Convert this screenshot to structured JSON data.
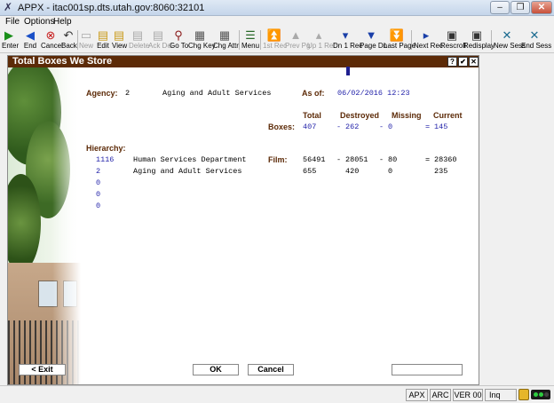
{
  "window": {
    "title": "APPX - itac001sp.dts.utah.gov:8060:32101",
    "min": "–",
    "max": "❐",
    "close": "✕"
  },
  "menu": [
    "File",
    "Options",
    "Help"
  ],
  "toolbar": [
    {
      "label": "Enter",
      "icon": "enter-icon",
      "glyph": "▶",
      "color": "#1a8f1a",
      "disabled": false
    },
    {
      "label": "End",
      "icon": "end-icon",
      "glyph": "◀",
      "color": "#1a4fc7",
      "disabled": false
    },
    {
      "label": "Cancel",
      "icon": "cancel-icon",
      "glyph": "⊗",
      "color": "#c71a1a",
      "disabled": false
    },
    {
      "label": "Back",
      "icon": "back-icon",
      "glyph": "↶",
      "color": "#333333",
      "disabled": false
    },
    {
      "label": "New",
      "icon": "new-icon",
      "glyph": "▭",
      "color": "#999999",
      "disabled": true
    },
    {
      "label": "Edit",
      "icon": "edit-icon",
      "glyph": "▤",
      "color": "#c99a1a",
      "disabled": false
    },
    {
      "label": "View",
      "icon": "view-icon",
      "glyph": "▤",
      "color": "#c99a1a",
      "disabled": false
    },
    {
      "label": "Delete",
      "icon": "delete-icon",
      "glyph": "▤",
      "color": "#999999",
      "disabled": true
    },
    {
      "label": "Ack Del",
      "icon": "ack-delete-icon",
      "glyph": "▤",
      "color": "#999999",
      "disabled": true
    },
    {
      "label": "Go To",
      "icon": "goto-icon",
      "glyph": "⚲",
      "color": "#8a1a1a",
      "disabled": false
    },
    {
      "label": "Chg Key",
      "icon": "change-key-icon",
      "glyph": "▦",
      "color": "#555555",
      "disabled": false
    },
    {
      "label": "Chg Attr",
      "icon": "change-attr-icon",
      "glyph": "▦",
      "color": "#555555",
      "disabled": false
    },
    {
      "label": "Menu",
      "icon": "menu-icon",
      "glyph": "☰",
      "color": "#2a6a2a",
      "disabled": false
    },
    {
      "label": "1st Rec",
      "icon": "first-record-icon",
      "glyph": "⏫",
      "color": "#999999",
      "disabled": true
    },
    {
      "label": "Prev Pg",
      "icon": "previous-page-icon",
      "glyph": "▲",
      "color": "#999999",
      "disabled": true
    },
    {
      "label": "Up 1 Rec",
      "icon": "up-record-icon",
      "glyph": "▴",
      "color": "#999999",
      "disabled": true
    },
    {
      "label": "Dn 1 Rec",
      "icon": "down-record-icon",
      "glyph": "▾",
      "color": "#1a3fa8",
      "disabled": false
    },
    {
      "label": "Page Dn",
      "icon": "page-down-icon",
      "glyph": "▼",
      "color": "#1a3fa8",
      "disabled": false
    },
    {
      "label": "Last Page",
      "icon": "last-page-icon",
      "glyph": "⏬",
      "color": "#1a3fa8",
      "disabled": false
    },
    {
      "label": "Next Rec",
      "icon": "next-record-icon",
      "glyph": "▸",
      "color": "#1a3fa8",
      "disabled": false
    },
    {
      "label": "Rescroll",
      "icon": "rescroll-icon",
      "glyph": "▣",
      "color": "#333333",
      "disabled": false
    },
    {
      "label": "Redisplay",
      "icon": "redisplay-icon",
      "glyph": "▣",
      "color": "#333333",
      "disabled": false
    },
    {
      "label": "New Sess",
      "icon": "new-session-icon",
      "glyph": "✕",
      "color": "#1a6a8f",
      "disabled": false
    },
    {
      "label": "End Sess",
      "icon": "end-session-icon",
      "glyph": "✕",
      "color": "#1a6a8f",
      "disabled": false
    }
  ],
  "form": {
    "header_title": "Total Boxes We Store",
    "header_buttons": [
      "?",
      "✔",
      "✕"
    ],
    "agency_label": "Agency:",
    "agency_code": "2",
    "agency_name": "Aging and Adult Services",
    "as_of_label": "As of:",
    "as_of_value": "06/02/2016 12:23",
    "col_total": "Total",
    "col_destroyed": "Destroyed",
    "col_missing": "Missing",
    "col_current": "Current",
    "boxes_label": "Boxes:",
    "boxes": {
      "total": "407",
      "minus1": "-",
      "destroyed": "262",
      "minus2": "-",
      "missing": "0",
      "equals": "=",
      "current": "145"
    },
    "hierarchy_label": "Hierarchy:",
    "hierarchy": [
      {
        "code": "1116",
        "name": "Human Services Department"
      },
      {
        "code": "2",
        "name": "Aging and Adult Services"
      },
      {
        "code": "0",
        "name": ""
      },
      {
        "code": "0",
        "name": ""
      },
      {
        "code": "0",
        "name": ""
      }
    ],
    "film_label": "Film:",
    "film_rows": [
      {
        "total": "56491",
        "sep1": "-",
        "destroyed": "28051",
        "sep2": "-",
        "missing": "80",
        "sep3": "=",
        "current": "28360"
      },
      {
        "total": "655",
        "sep1": "",
        "destroyed": "420",
        "sep2": "",
        "missing": "0",
        "sep3": "",
        "current": "235"
      }
    ],
    "exit_button": "< Exit",
    "ok_button": "OK",
    "cancel_button": "Cancel",
    "blank_field": ""
  },
  "status": [
    "APX",
    "ARC",
    "VER 00",
    "Inq"
  ],
  "colors": {
    "header_brown": "#5c2a07",
    "label_brown": "#5c2a07",
    "value_blue": "#1f1fa8"
  }
}
